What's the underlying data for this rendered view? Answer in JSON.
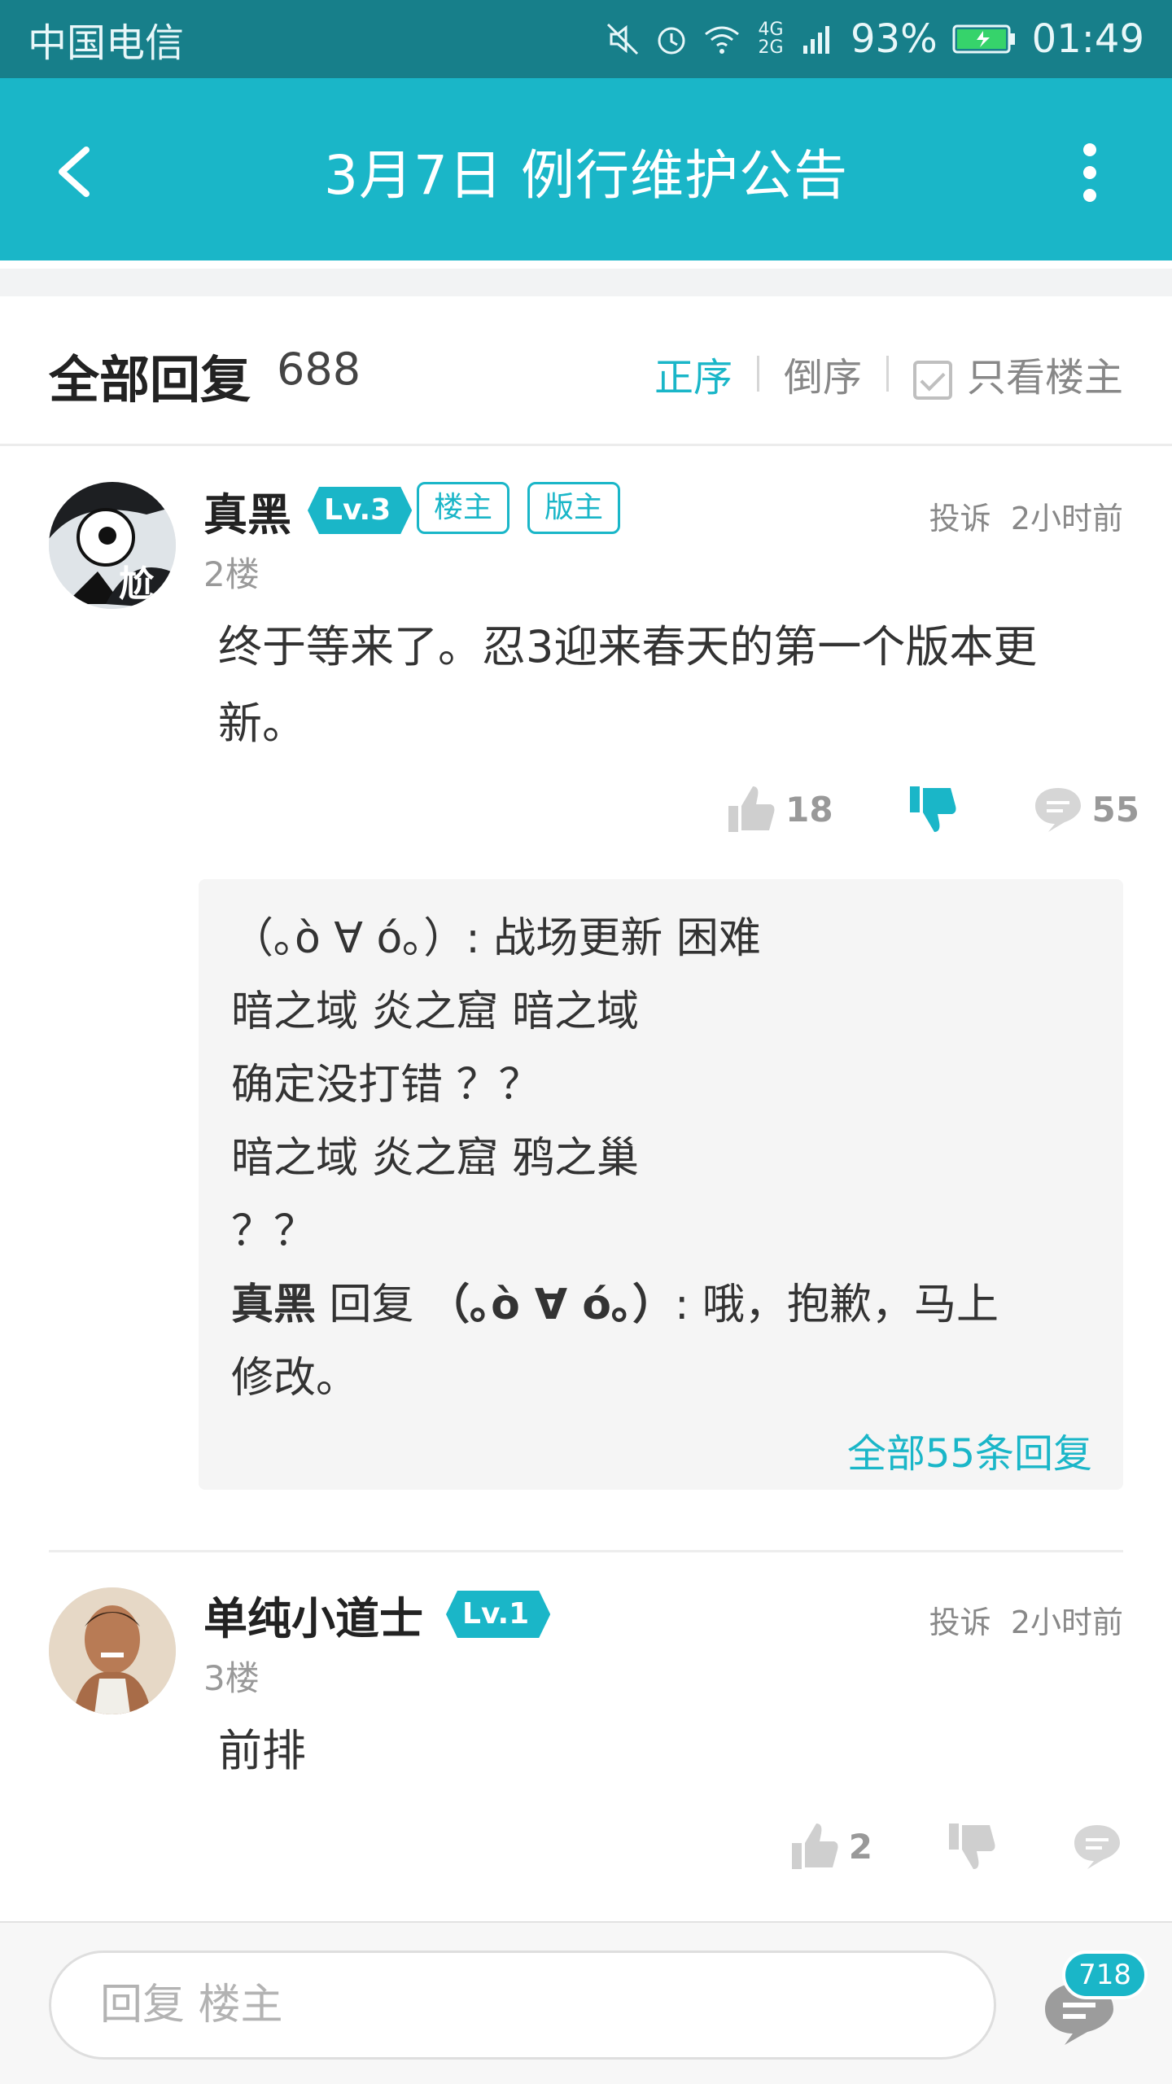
{
  "status_bar": {
    "carrier": "中国电信",
    "network": "4G 2G",
    "battery": "93%",
    "time": "01:49"
  },
  "header": {
    "title": "3月7日 例行维护公告",
    "back_icon": "chevron-left-icon",
    "more_icon": "more-vertical-icon"
  },
  "reply_header": {
    "label": "全部回复",
    "count": "688",
    "sort_asc": "正序",
    "sort_desc": "倒序",
    "owner_only": "只看楼主"
  },
  "comments": [
    {
      "username": "真黑",
      "level": "Lv.3",
      "tags": [
        "楼主",
        "版主"
      ],
      "report": "投诉",
      "time": "2小时前",
      "floor": "2楼",
      "content_line1": "终于等来了。忍3迎来春天的第一个版本更",
      "content_line2": "新。",
      "likes": "18",
      "comments_count": "55",
      "sub_replies": {
        "line1": "（｡ò ∀ ó｡）: 战场更新  困难",
        "line2": "暗之域 炎之窟 暗之域",
        "line3": "确定没打错  ？？",
        "line4": "暗之域 炎之窟  鸦之巢",
        "line5": "？？",
        "reply_author": "真黑",
        "reply_word": "回复",
        "reply_target": "（｡ò ∀ ó｡）",
        "reply_text1": ": 哦，抱歉，马上",
        "reply_text2": "修改。",
        "more": "全部55条回复"
      }
    },
    {
      "username": "单纯小道士",
      "level": "Lv.1",
      "report": "投诉",
      "time": "2小时前",
      "floor": "3楼",
      "content_line1": "前排",
      "likes": "2"
    }
  ],
  "bottom_bar": {
    "placeholder": "回复  楼主",
    "badge": "718"
  },
  "colors": {
    "status": "#177f8a",
    "accent": "#1ab6c8"
  }
}
